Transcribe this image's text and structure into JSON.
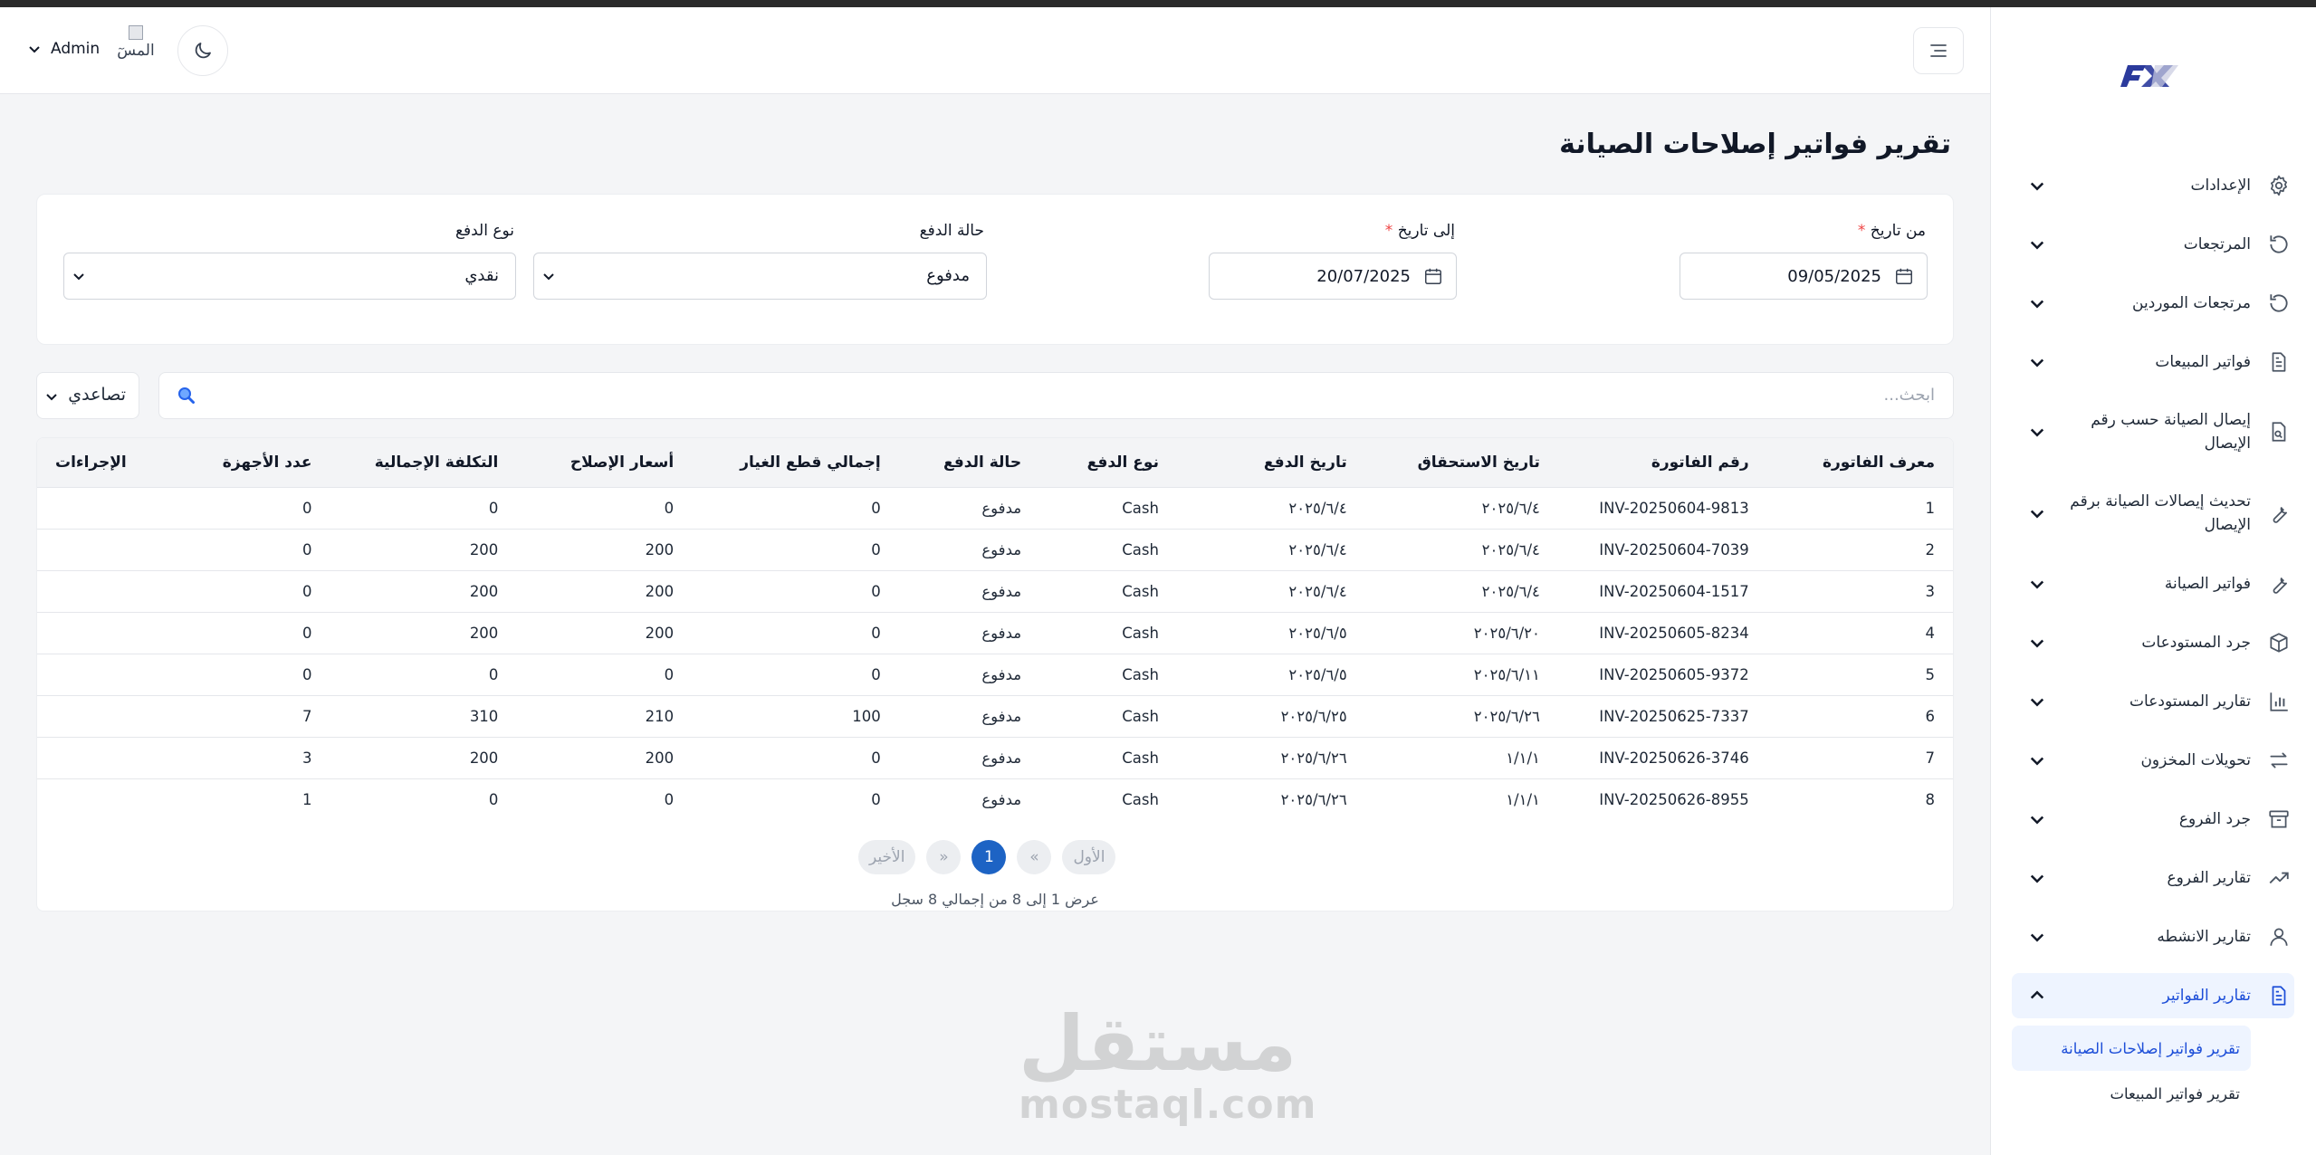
{
  "header": {
    "user_name": "Admin",
    "avatar_alt": "المسٓ"
  },
  "page": {
    "title": "تقرير فواتير إصلاحات الصيانة"
  },
  "filters": {
    "from_date_label": "من تاريخ",
    "from_date_value": "09/05/2025",
    "to_date_label": "إلى تاريخ",
    "to_date_value": "20/07/2025",
    "payment_status_label": "حالة الدفع",
    "payment_status_value": "مدفوع",
    "payment_type_label": "نوع الدفع",
    "payment_type_value": "نقدي",
    "required_mark": "*"
  },
  "search": {
    "placeholder": "ابحث...",
    "sort_value": "تصاعدي"
  },
  "table": {
    "columns": [
      "معرف الفاتورة",
      "رقم الفاتورة",
      "تاريخ الاستحقاق",
      "تاريخ الدفع",
      "نوع الدفع",
      "حالة الدفع",
      "إجمالي قطع الغيار",
      "أسعار الإصلاح",
      "التكلفة الإجمالية",
      "عدد الأجهزة",
      "الإجراءات"
    ],
    "rows": [
      [
        "1",
        "INV-20250604-9813",
        "٢٠٢٥/٦/٤",
        "٢٠٢٥/٦/٤",
        "Cash",
        "مدفوع",
        "0",
        "0",
        "0",
        "0"
      ],
      [
        "2",
        "INV-20250604-7039",
        "٢٠٢٥/٦/٤",
        "٢٠٢٥/٦/٤",
        "Cash",
        "مدفوع",
        "0",
        "200",
        "200",
        "0"
      ],
      [
        "3",
        "INV-20250604-1517",
        "٢٠٢٥/٦/٤",
        "٢٠٢٥/٦/٤",
        "Cash",
        "مدفوع",
        "0",
        "200",
        "200",
        "0"
      ],
      [
        "4",
        "INV-20250605-8234",
        "٢٠٢٥/٦/٢٠",
        "٢٠٢٥/٦/٥",
        "Cash",
        "مدفوع",
        "0",
        "200",
        "200",
        "0"
      ],
      [
        "5",
        "INV-20250605-9372",
        "٢٠٢٥/٦/١١",
        "٢٠٢٥/٦/٥",
        "Cash",
        "مدفوع",
        "0",
        "0",
        "0",
        "0"
      ],
      [
        "6",
        "INV-20250625-7337",
        "٢٠٢٥/٦/٢٦",
        "٢٠٢٥/٦/٢٥",
        "Cash",
        "مدفوع",
        "100",
        "210",
        "310",
        "7"
      ],
      [
        "7",
        "INV-20250626-3746",
        "١/١/١",
        "٢٠٢٥/٦/٢٦",
        "Cash",
        "مدفوع",
        "0",
        "200",
        "200",
        "3"
      ],
      [
        "8",
        "INV-20250626-8955",
        "١/١/١",
        "٢٠٢٥/٦/٢٦",
        "Cash",
        "مدفوع",
        "0",
        "0",
        "0",
        "1"
      ]
    ]
  },
  "pagination": {
    "first": "الأول",
    "prev": "«",
    "current": "1",
    "next": "»",
    "last": "الأخير",
    "summary": "عرض 1 إلى 8 من إجمالي 8 سجل"
  },
  "sidebar": {
    "items": [
      {
        "label": "الإعدادات",
        "icon": "gear-icon"
      },
      {
        "label": "المرتجعات",
        "icon": "undo-icon"
      },
      {
        "label": "مرتجعات الموردين",
        "icon": "undo-icon"
      },
      {
        "label": "فواتير المبيعات",
        "icon": "document-icon"
      },
      {
        "label": "إيصال الصيانة حسب رقم الإيصال",
        "icon": "file-search-icon"
      },
      {
        "label": "تحديث إيصالات الصيانة برقم الإيصال",
        "icon": "wrench-icon"
      },
      {
        "label": "فواتير الصيانة",
        "icon": "wrench-icon"
      },
      {
        "label": "جرد المستودعات",
        "icon": "box-icon"
      },
      {
        "label": "تقارير المستودعات",
        "icon": "bar-chart-icon"
      },
      {
        "label": "تحويلات المخزون",
        "icon": "transfer-icon"
      },
      {
        "label": "جرد الفروع",
        "icon": "archive-icon"
      },
      {
        "label": "تقارير الفروع",
        "icon": "trend-icon"
      },
      {
        "label": "تقارير الانشطه",
        "icon": "user-icon"
      },
      {
        "label": "تقارير الفواتير",
        "icon": "document-icon"
      }
    ],
    "sub_items": [
      "تقرير فواتير إصلاحات الصيانة",
      "تقرير فواتير المبيعات"
    ]
  },
  "watermark": {
    "arabic": "مستقل",
    "latin": "mostaql.com"
  },
  "colors": {
    "accent": "#1d63c4",
    "active_bg": "#eef4ff",
    "required": "#ef4444"
  }
}
